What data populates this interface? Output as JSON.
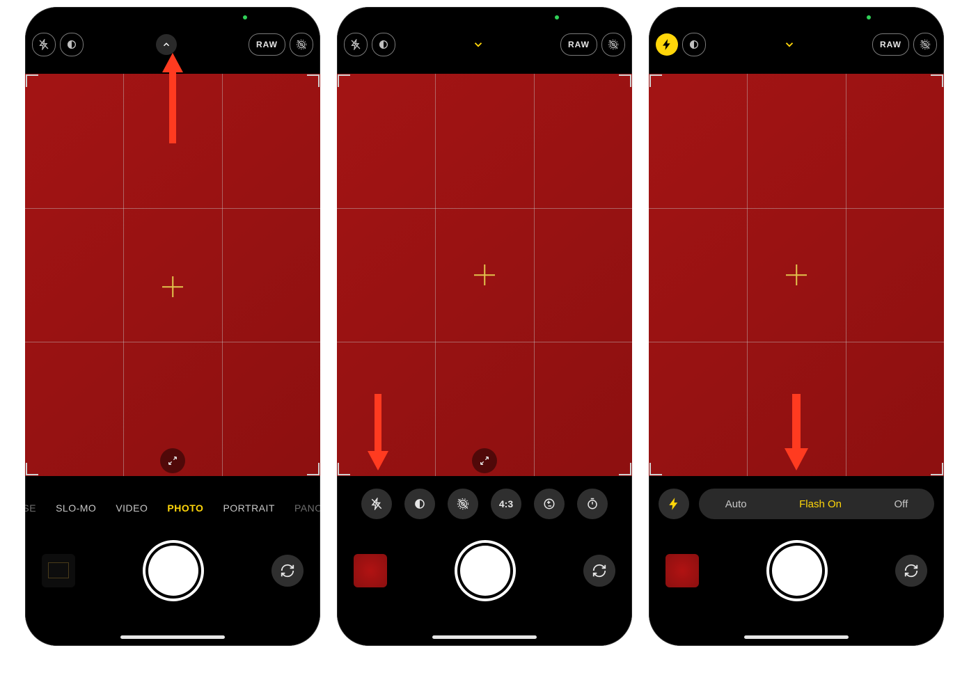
{
  "screens": [
    {
      "chevron_direction": "up",
      "chevron_color": "white",
      "flash_on": false,
      "arrow": {
        "dir": "up",
        "x_center": true
      },
      "modes": [
        "SE",
        "SLO-MO",
        "VIDEO",
        "PHOTO",
        "PORTRAIT",
        "PANO"
      ],
      "active_mode": "PHOTO",
      "thumb": "dark",
      "bottom_variant": "modes"
    },
    {
      "chevron_direction": "down",
      "chevron_color": "yellow",
      "flash_on": false,
      "arrow": {
        "dir": "down",
        "x": 40
      },
      "tools": {
        "aspect": "4:3"
      },
      "thumb": "red",
      "bottom_variant": "tools"
    },
    {
      "chevron_direction": "down",
      "chevron_color": "yellow",
      "flash_on": true,
      "arrow": {
        "dir": "down",
        "x_center": true,
        "xoff": 460
      },
      "flash_options": [
        "Auto",
        "Flash On",
        "Off"
      ],
      "flash_selected": "Flash On",
      "thumb": "red",
      "bottom_variant": "flash"
    }
  ],
  "raw_label": "RAW"
}
